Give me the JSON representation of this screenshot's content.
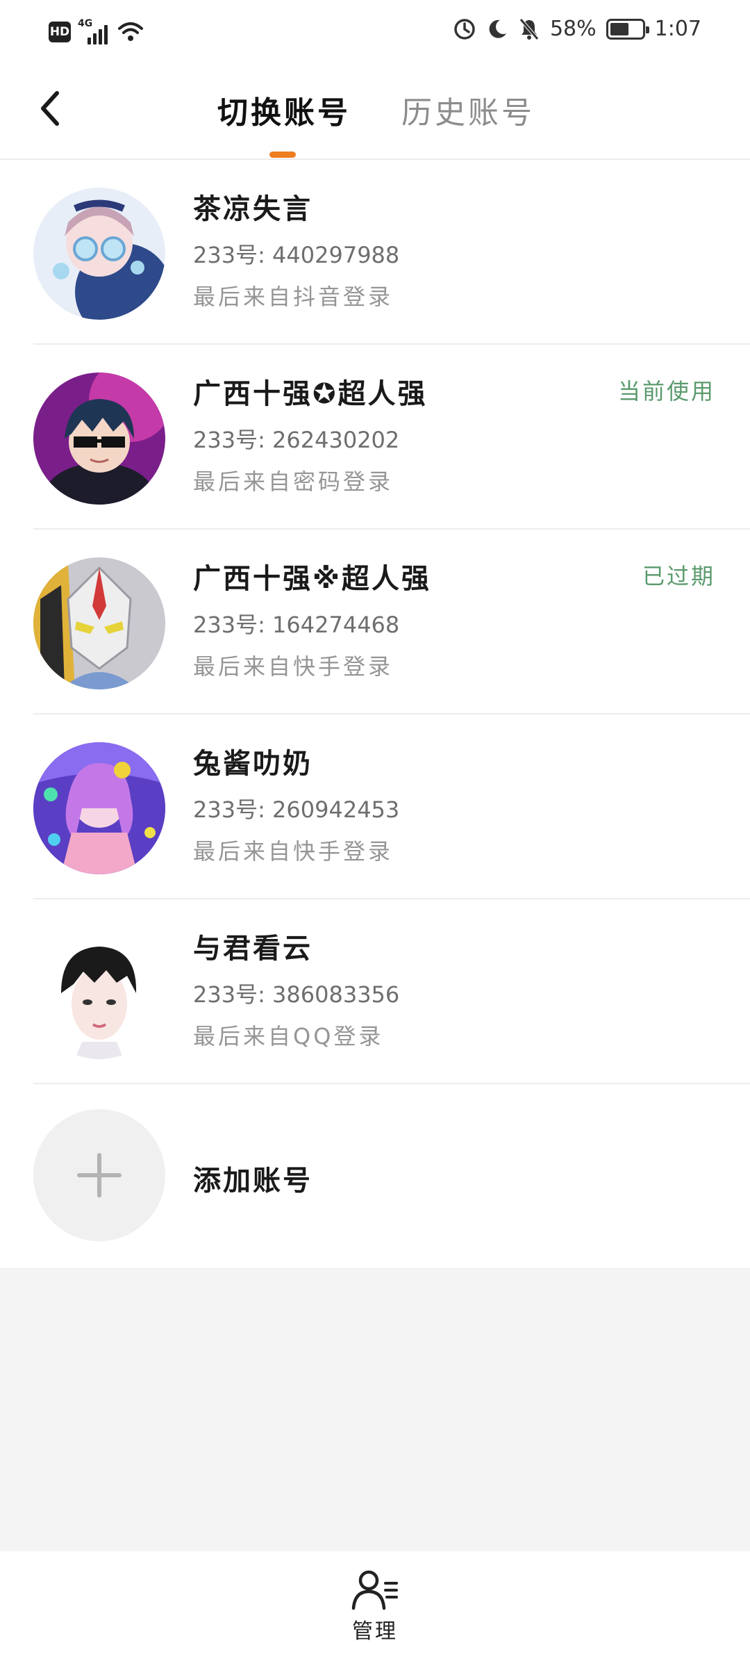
{
  "status_bar": {
    "hd": "HD",
    "network": "4G",
    "battery_percent": "58%",
    "battery_level": 0.58,
    "time": "1:07"
  },
  "header": {
    "tabs": [
      {
        "label": "切换账号",
        "active": true
      },
      {
        "label": "历史账号",
        "active": false
      }
    ],
    "accent_color": "#ef7d22"
  },
  "accounts": [
    {
      "name": "茶凉失言",
      "uid": "233号: 440297988",
      "source": "最后来自抖音登录",
      "status": ""
    },
    {
      "name": "广西十强✪超人强",
      "uid": "233号: 262430202",
      "source": "最后来自密码登录",
      "status": "当前使用"
    },
    {
      "name": "广西十强※超人强",
      "uid": "233号: 164274468",
      "source": "最后来自快手登录",
      "status": "已过期"
    },
    {
      "name": "兔酱叻奶",
      "uid": "233号: 260942453",
      "source": "最后来自快手登录",
      "status": ""
    },
    {
      "name": "与君看云",
      "uid": "233号: 386083356",
      "source": "最后来自QQ登录",
      "status": ""
    }
  ],
  "add_account": {
    "label": "添加账号"
  },
  "bottom_bar": {
    "manage_label": "管理"
  },
  "colors": {
    "status_green": "#5a9a6c",
    "background": "#f4f4f5"
  }
}
